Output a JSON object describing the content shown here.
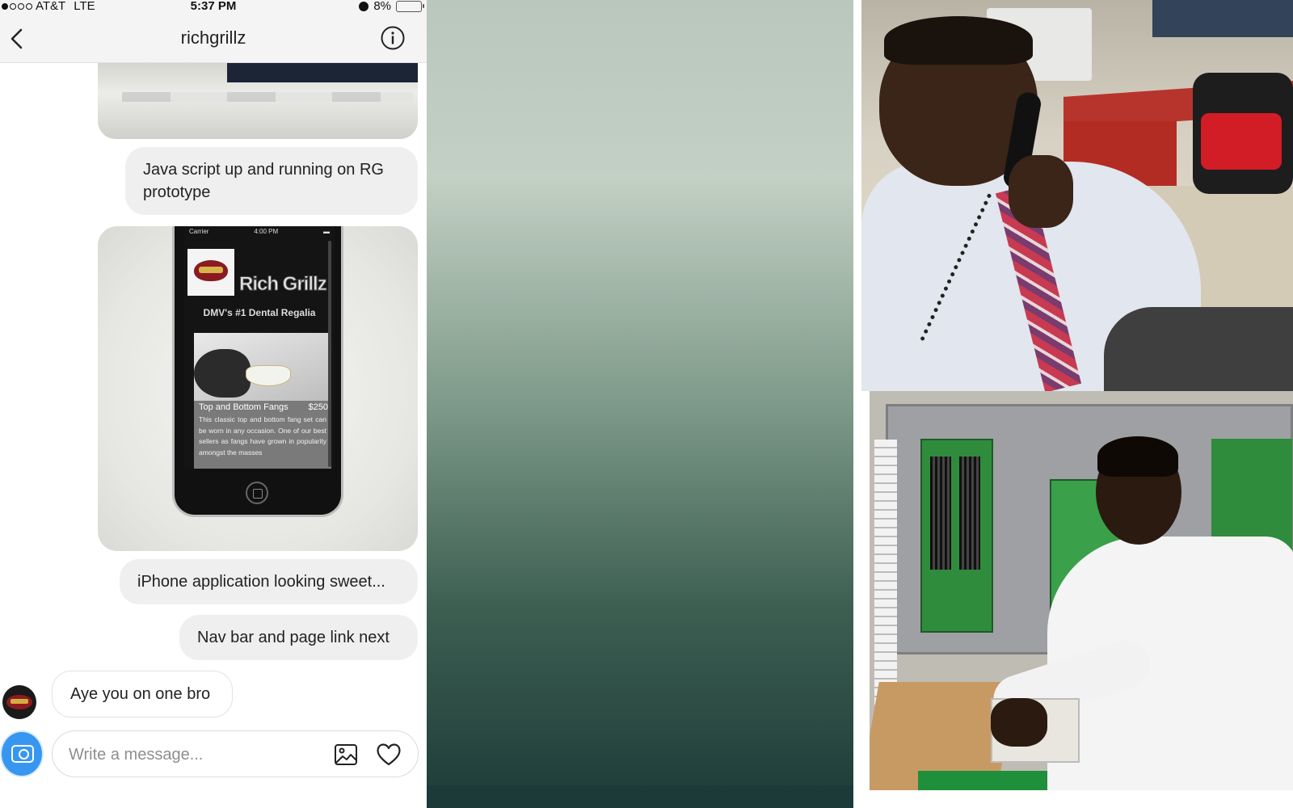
{
  "status_bar": {
    "carrier": "AT&T",
    "network": "LTE",
    "time": "5:37 PM",
    "battery_percent": "8%",
    "battery_level": 0.08,
    "signal_dots_filled": 1,
    "signal_dots_total": 5
  },
  "header": {
    "title": "richgrillz",
    "back_icon": "chevron-left-icon",
    "info_icon": "info-circle-icon"
  },
  "messages": [
    {
      "type": "image",
      "from": "me",
      "description_hidden": true
    },
    {
      "type": "text",
      "from": "me",
      "text": "Java script up and running on RG prototype"
    },
    {
      "type": "image",
      "from": "me"
    },
    {
      "type": "text",
      "from": "me",
      "text": "iPhone application looking sweet..."
    },
    {
      "type": "text",
      "from": "me",
      "text": "Nav bar and page link next"
    },
    {
      "type": "text",
      "from": "them",
      "text": "Aye you on one bro"
    }
  ],
  "prototype_screen": {
    "carrier": "Carrier",
    "time": "4:00 PM",
    "brand": "Rich Grillz",
    "tagline": "DMV's #1 Dental Regalia",
    "product_title": "Top and Bottom Fangs",
    "product_price": "$250",
    "product_desc": "This classic top and bottom fang set can be worn in any occasion. One of our best sellers as fangs have grown in popularity amongst the masses"
  },
  "composer": {
    "placeholder": "Write a message...",
    "camera_icon": "camera-icon",
    "gallery_icon": "gallery-icon",
    "like_icon": "heart-icon"
  },
  "colors": {
    "accent_blue": "#3797f0",
    "bubble_grey": "#efefef",
    "battery_yellow": "#f2c200"
  }
}
